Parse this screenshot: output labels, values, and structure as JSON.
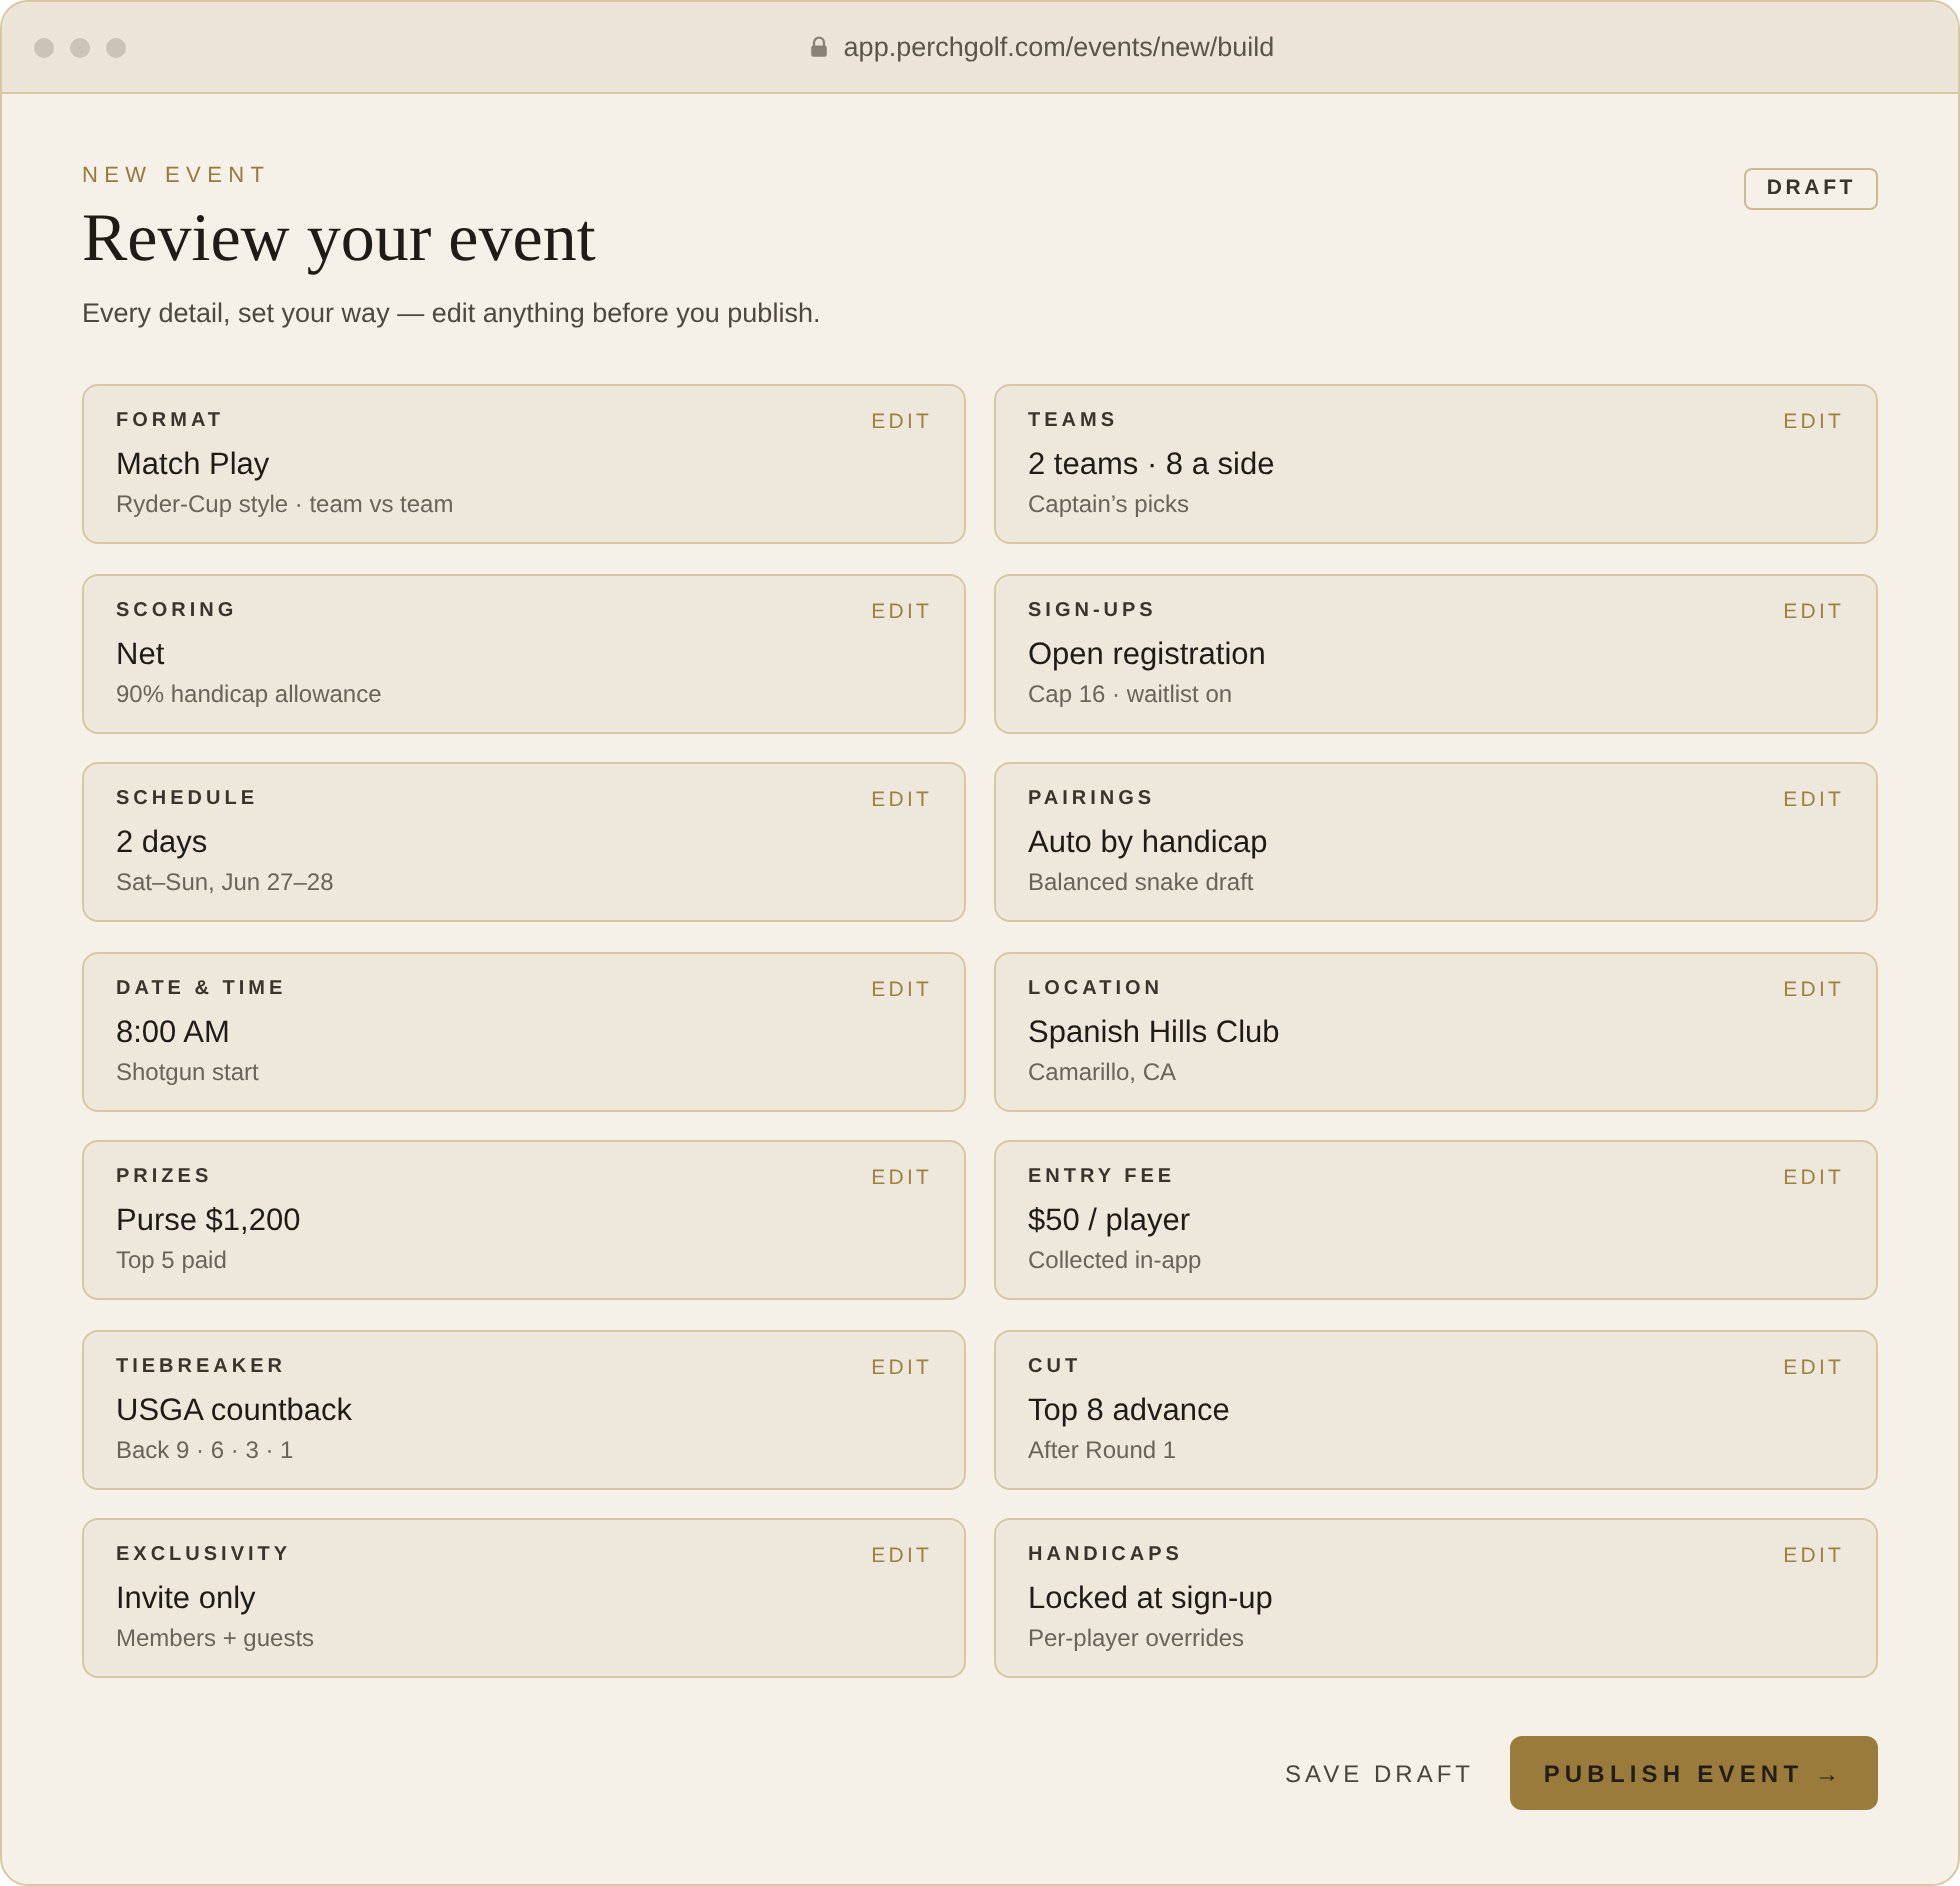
{
  "browser": {
    "url": "app.perchgolf.com/events/new/build"
  },
  "header": {
    "eyebrow": "NEW EVENT",
    "title": "Review your event",
    "subtitle": "Every detail, set your way — edit anything before you publish.",
    "status_badge": "DRAFT"
  },
  "cards": [
    {
      "label": "FORMAT",
      "value": "Match Play",
      "detail": "Ryder-Cup style · team vs team",
      "action": "EDIT"
    },
    {
      "label": "TEAMS",
      "value": "2 teams · 8 a side",
      "detail": "Captain’s picks",
      "action": "EDIT"
    },
    {
      "label": "SCORING",
      "value": "Net",
      "detail": "90% handicap allowance",
      "action": "EDIT"
    },
    {
      "label": "SIGN-UPS",
      "value": "Open registration",
      "detail": "Cap 16 · waitlist on",
      "action": "EDIT"
    },
    {
      "label": "SCHEDULE",
      "value": "2 days",
      "detail": "Sat–Sun, Jun 27–28",
      "action": "EDIT"
    },
    {
      "label": "PAIRINGS",
      "value": "Auto by handicap",
      "detail": "Balanced snake draft",
      "action": "EDIT"
    },
    {
      "label": "DATE & TIME",
      "value": "8:00 AM",
      "detail": "Shotgun start",
      "action": "EDIT"
    },
    {
      "label": "LOCATION",
      "value": "Spanish Hills Club",
      "detail": "Camarillo, CA",
      "action": "EDIT"
    },
    {
      "label": "PRIZES",
      "value": "Purse $1,200",
      "detail": "Top 5 paid",
      "action": "EDIT"
    },
    {
      "label": "ENTRY FEE",
      "value": "$50 / player",
      "detail": "Collected in-app",
      "action": "EDIT"
    },
    {
      "label": "TIEBREAKER",
      "value": "USGA countback",
      "detail": "Back 9 · 6 · 3 · 1",
      "action": "EDIT"
    },
    {
      "label": "CUT",
      "value": "Top 8 advance",
      "detail": "After Round 1",
      "action": "EDIT"
    },
    {
      "label": "EXCLUSIVITY",
      "value": "Invite only",
      "detail": "Members + guests",
      "action": "EDIT"
    },
    {
      "label": "HANDICAPS",
      "value": "Locked at sign-up",
      "detail": "Per-player overrides",
      "action": "EDIT"
    }
  ],
  "actions": {
    "secondary": "SAVE DRAFT",
    "primary": "PUBLISH EVENT →"
  }
}
